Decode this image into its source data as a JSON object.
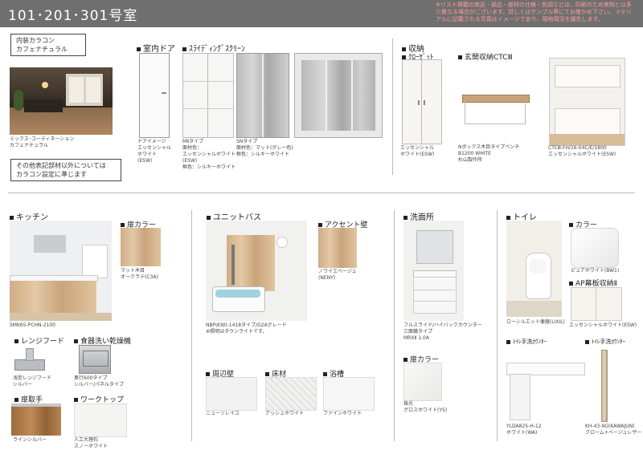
{
  "header": {
    "title": "101･201･301号室",
    "note": "※リスト掲載の商品・部品・部材の仕様・色調などは、印刷のため実物とは多少異なる場合がございます。詳しくはサンプル等にてお確かめ下さい。マテリアルに記載される写真はイメージであり、現地現況を優先します。"
  },
  "interior": {
    "heading": "内装カラコン\nカフェナチュラル",
    "room_caption": "ミックス･コーディネーション\nカフェナチュラル",
    "note": "その他表記部材以外については\nカラコン設定に準じます"
  },
  "door": {
    "heading": "室内ドア",
    "caption": "ドアイメージ\nエッセンシャル\nホワイト\n(ESW)"
  },
  "screen": {
    "heading": "ｽﾗｲﾃﾞｨﾝｸﾞｽｸﾘｰﾝ",
    "m2_caption": "MⅡタイプ\n面材色：\nエッセンシャルホワイト\n(ESW)\n框色：シルキーホワイト",
    "sn_caption": "SNタイプ\n面材色：マット(グレー色)\n框色：シルキーホワイト"
  },
  "storage": {
    "heading": "収納",
    "closet_heading": "ｸﾛｰｾﾞｯﾄ",
    "closet_caption": "エッセンシャル\nホワイト(ESW)",
    "entrance_heading": "玄関収納CTCⅢ",
    "bench_caption": "Nボックス木目タイプベンチ\nB1200 WHITE\n杉山製作所",
    "ctc_caption": "CTCⅢ-FH/16-04C/E/1800\nエッセンシャルホワイト(ESW)"
  },
  "kitchen": {
    "heading": "キッチン",
    "caption": "SMK65-PCHN-2100",
    "door_color_heading": "扉カラー",
    "door_color_caption": "マット木目\nオークラテ(C3A)",
    "range_hood_heading": "レンジフード",
    "range_hood_caption": "浅型レンジフード\nシルバー",
    "dishwasher_heading": "食器洗い乾燥機",
    "dishwasher_caption": "奥行600タイプ\nシルバー/パネルタイプ",
    "handle_heading": "扉取手",
    "handle_caption": "ラインシルバー",
    "worktop_heading": "ワークトップ",
    "worktop_caption": "人工大理石\nスノーホワイト"
  },
  "bath": {
    "heading": "ユニットバス",
    "caption": "NBPd(W)-1418タイプ/G2Aグレード\n※照明はダウンライトです。",
    "accent_heading": "アクセント壁",
    "accent_caption": "ノワイエベージュ\n(NENY)",
    "wall_heading": "周辺壁",
    "wall_caption": "ニューソレイユ",
    "floor_heading": "床材",
    "floor_caption": "アッシュホワイト",
    "tub_heading": "浴槽",
    "tub_caption": "ファインホワイト"
  },
  "washroom": {
    "heading": "洗面所",
    "caption": "フルスライド/ハイバックカウンター\n三面鏡タイプ\nMRXⅡ 1.0A",
    "door_color_heading": "扉カラー",
    "door_color_caption": "珠光\nグロスホワイト(YS)"
  },
  "toilet": {
    "heading": "トイレ",
    "caption": "ローシルエット便器(LIXIL)",
    "color_heading": "カラー",
    "color_caption": "ピュアホワイト(BW1)",
    "ap_heading": "AP幕板収納Ⅱ",
    "ap_caption": "エッセンシャルホワイト(ESW)",
    "sink1_heading": "ﾄｲﾚ手洗ｶｳﾝﾀｰ",
    "sink1_caption": "YLDA825-H-12\nホワイト(WA)",
    "sink2_heading": "ﾄｲﾚ手洗ｶｳﾝﾀｰ",
    "sink2_caption": "KH-43-9G(KAWAJUN)\nクローム+ベージュレザー"
  },
  "colors": {
    "header_bg": "#6f6f6f",
    "note_text": "#ff9b9b",
    "wood_light": "#dcbf99",
    "wood_dark": "#a87548"
  }
}
